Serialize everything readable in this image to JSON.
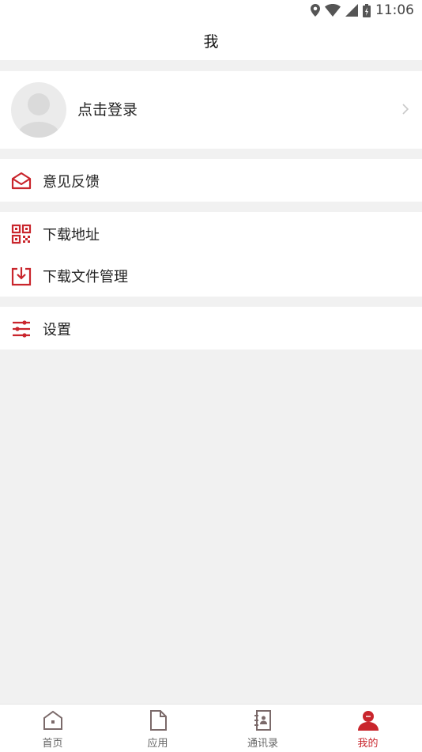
{
  "status": {
    "time": "11:06"
  },
  "header": {
    "title": "我"
  },
  "login": {
    "label": "点击登录"
  },
  "menu": {
    "feedback": "意见反馈",
    "download_address": "下载地址",
    "download_files": "下载文件管理",
    "settings": "设置"
  },
  "tabs": [
    {
      "label": "首页",
      "icon": "home-icon"
    },
    {
      "label": "应用",
      "icon": "document-icon"
    },
    {
      "label": "通讯录",
      "icon": "contacts-icon"
    },
    {
      "label": "我的",
      "icon": "user-icon",
      "active": true
    }
  ],
  "colors": {
    "accent": "#c9252c",
    "background": "#f1f1f1",
    "inactive_icon": "#7b6a6a"
  }
}
